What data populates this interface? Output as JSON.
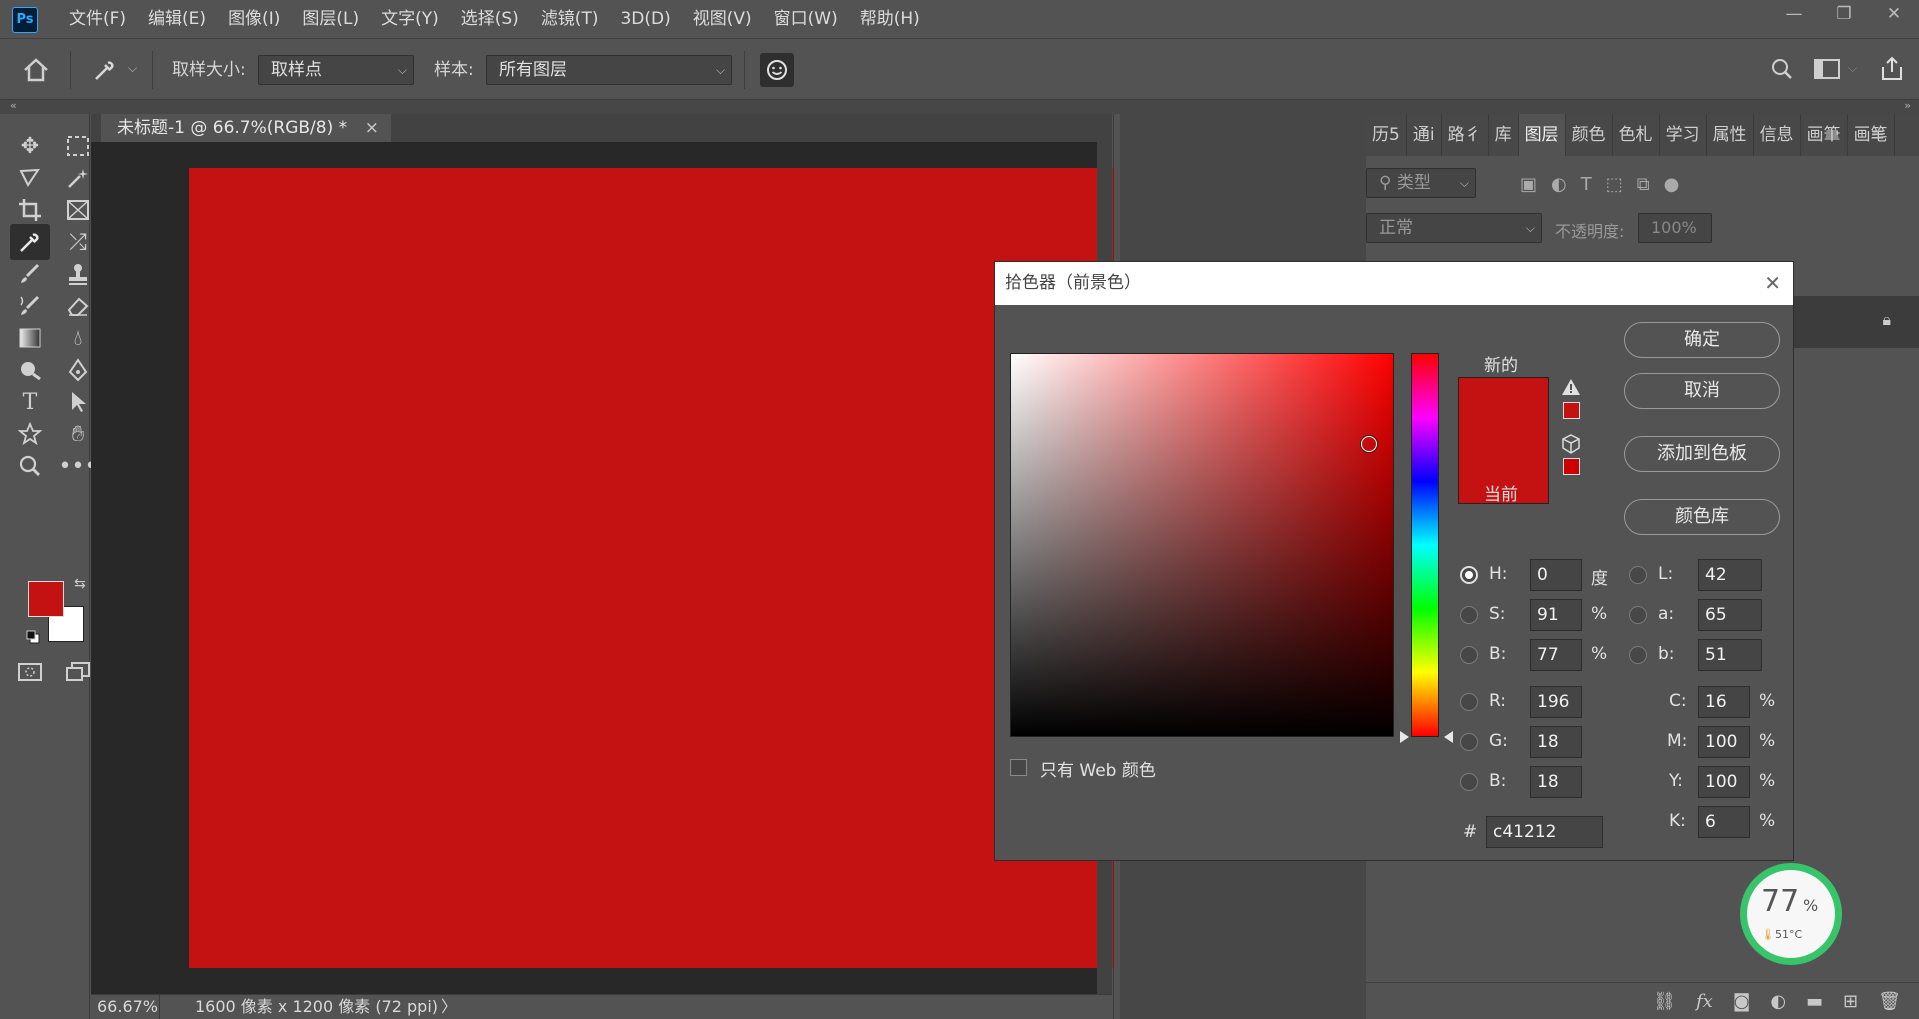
{
  "app": {
    "logo": "Ps"
  },
  "menu": [
    "文件(F)",
    "编辑(E)",
    "图像(I)",
    "图层(L)",
    "文字(Y)",
    "选择(S)",
    "滤镜(T)",
    "3D(D)",
    "视图(V)",
    "窗口(W)",
    "帮助(H)"
  ],
  "window_controls": {
    "minimize": "—",
    "restore": "❐",
    "close": "✕"
  },
  "options": {
    "sample_size_label": "取样大小:",
    "sample_size_value": "取样点",
    "sample_label": "样本:",
    "sample_value": "所有图层"
  },
  "document": {
    "tab_title": "未标题-1 @ 66.7%(RGB/8) *",
    "tab_close": "×",
    "zoom": "66.67%",
    "dimensions": "1600 像素 x 1200 像素 (72 ppi)",
    "status_arrow": "〉",
    "fill_color": "#c41212"
  },
  "panels": {
    "tabs": [
      "历5",
      "通i",
      "路彳",
      "库",
      "图层",
      "颜色",
      "色札",
      "学习",
      "属性",
      "信息",
      "画筆",
      "画笔"
    ],
    "active_tab": "图层",
    "filter_placeholder": "类型",
    "blend_mode": "正常",
    "opacity_label": "不透明度:",
    "opacity_value": "100%"
  },
  "color_picker": {
    "title": "拾色器（前景色）",
    "close": "✕",
    "new_label": "新的",
    "current_label": "当前",
    "new_color": "#c41212",
    "current_color": "#c41212",
    "buttons": {
      "ok": "确定",
      "cancel": "取消",
      "add_swatch": "添加到色板",
      "color_libraries": "颜色库"
    },
    "web_only_label": "只有 Web 颜色",
    "hsb": {
      "h_label": "H:",
      "h": "0",
      "h_unit": "度",
      "s_label": "S:",
      "s": "91",
      "s_unit": "%",
      "b_label": "B:",
      "b": "77",
      "b_unit": "%"
    },
    "lab": {
      "l_label": "L:",
      "l": "42",
      "a_label": "a:",
      "a": "65",
      "b_label": "b:",
      "b": "51"
    },
    "rgb": {
      "r_label": "R:",
      "r": "196",
      "g_label": "G:",
      "g": "18",
      "b_label": "B:",
      "b": "18"
    },
    "cmyk": {
      "c_label": "C:",
      "c": "16",
      "m_label": "M:",
      "m": "100",
      "y_label": "Y:",
      "y": "100",
      "k_label": "K:",
      "k": "6",
      "unit": "%"
    },
    "hex_label": "#",
    "hex": "c41212",
    "selected_mode": "H"
  },
  "gauge": {
    "value": "77",
    "unit": "%",
    "temp": "51°C"
  }
}
